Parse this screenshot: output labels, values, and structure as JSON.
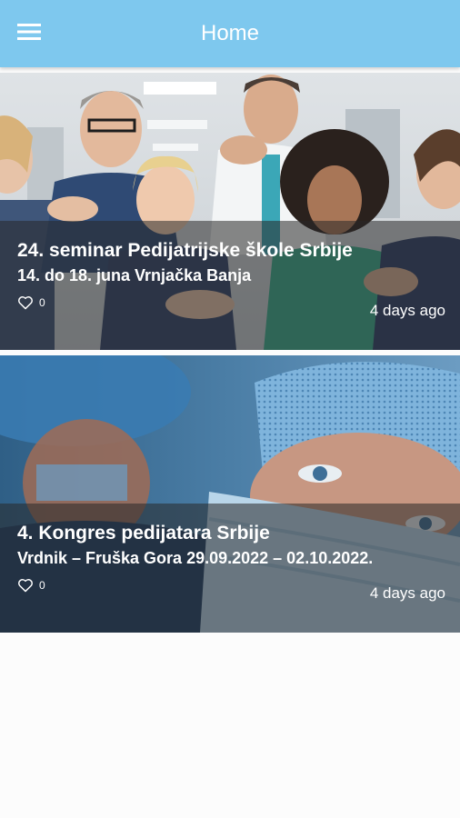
{
  "app_bar": {
    "title": "Home",
    "menu_icon": "hamburger-menu-icon",
    "background": "#7ec8ee"
  },
  "feed": {
    "items": [
      {
        "title": "24. seminar  Pedijatrijske škole Srbije",
        "subtitle": "14. do 18. juna  Vrnjačka Banja",
        "likes": "0",
        "like_icon": "heart-outline-icon",
        "time": "4 days ago"
      },
      {
        "title": "4. Kongres pedijatara Srbije",
        "subtitle": "Vrdnik – Fruška Gora 29.09.2022 – 02.10.2022.",
        "likes": "0",
        "like_icon": "heart-outline-icon",
        "time": "4 days ago"
      }
    ]
  }
}
